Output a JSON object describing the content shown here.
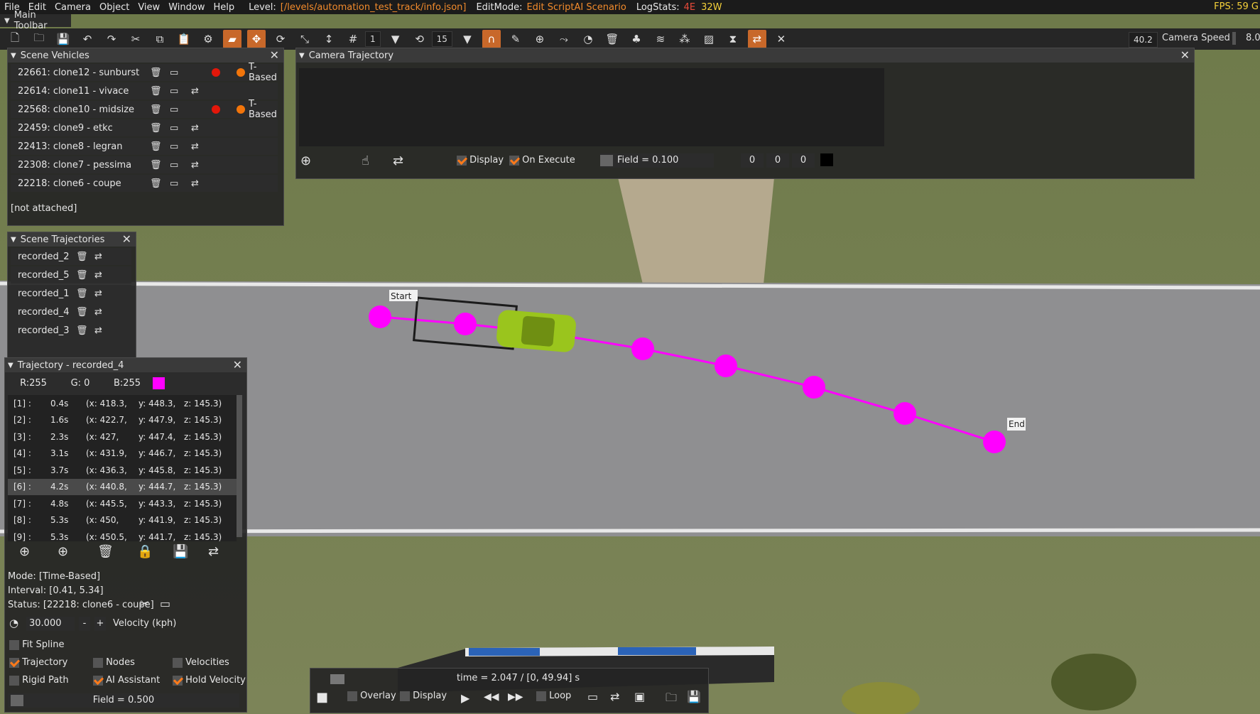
{
  "menu": {
    "items": [
      "File",
      "Edit",
      "Camera",
      "Object",
      "View",
      "Window",
      "Help"
    ],
    "level_label": "Level:",
    "level_value": "[/levels/automation_test_track/info.json]",
    "editmode_label": "EditMode:",
    "editmode_value": "Edit ScriptAI Scenario",
    "logstats_label": "LogStats:",
    "logstats_errors": "4E",
    "logstats_warnings": "32W",
    "fps": "FPS: 59 G"
  },
  "toolbar": {
    "title": "Main Toolbar",
    "value1": "1",
    "value2": "15",
    "speed_value": "40.2",
    "speed_label": "Camera Speed",
    "speed_value2": "8.0"
  },
  "vehicles": {
    "title": "Scene Vehicles",
    "rows": [
      {
        "name": "22661: clone12 - sunburst",
        "tbased": "T-Based"
      },
      {
        "name": "22614: clone11 - vivace",
        "tbased": ""
      },
      {
        "name": "22568: clone10 - midsize",
        "tbased": "T-Based"
      },
      {
        "name": "22459: clone9 - etkc",
        "tbased": ""
      },
      {
        "name": "22413: clone8 - legran",
        "tbased": ""
      },
      {
        "name": "22308: clone7 - pessima",
        "tbased": ""
      },
      {
        "name": "22218: clone6 - coupe",
        "tbased": ""
      }
    ],
    "status": "[not attached]"
  },
  "camera": {
    "title": "Camera Trajectory",
    "display": "Display",
    "on_execute": "On Execute",
    "field": "Field = 0.100",
    "n1": "0",
    "n2": "0",
    "n3": "0"
  },
  "trajectories": {
    "title": "Scene Trajectories",
    "rows": [
      "recorded_2",
      "recorded_5",
      "recorded_1",
      "recorded_4",
      "recorded_3"
    ]
  },
  "trajpanel": {
    "title": "Trajectory - recorded_4",
    "r": "R:255",
    "g": "G: 0",
    "b": "B:255",
    "color": "#ff00ff",
    "rows": [
      {
        "i": "[1] :",
        "t": "0.4s",
        "x": "(x: 418.3,",
        "y": "y: 448.3,",
        "z": "z: 145.3)"
      },
      {
        "i": "[2] :",
        "t": "1.6s",
        "x": "(x: 422.7,",
        "y": "y: 447.9,",
        "z": "z: 145.3)"
      },
      {
        "i": "[3] :",
        "t": "2.3s",
        "x": "(x: 427,",
        "y": "y: 447.4,",
        "z": "z: 145.3)"
      },
      {
        "i": "[4] :",
        "t": "3.1s",
        "x": "(x: 431.9,",
        "y": "y: 446.7,",
        "z": "z: 145.3)"
      },
      {
        "i": "[5] :",
        "t": "3.7s",
        "x": "(x: 436.3,",
        "y": "y: 445.8,",
        "z": "z: 145.3)"
      },
      {
        "i": "[6] :",
        "t": "4.2s",
        "x": "(x: 440.8,",
        "y": "y: 444.7,",
        "z": "z: 145.3)"
      },
      {
        "i": "[7] :",
        "t": "4.8s",
        "x": "(x: 445.5,",
        "y": "y: 443.3,",
        "z": "z: 145.3)"
      },
      {
        "i": "[8] :",
        "t": "5.3s",
        "x": "(x: 450,",
        "y": "y: 441.9,",
        "z": "z: 145.3)"
      },
      {
        "i": "[9] :",
        "t": "5.3s",
        "x": "(x: 450.5,",
        "y": "y: 441.7,",
        "z": "z: 145.3)"
      }
    ],
    "mode": "Mode: [Time-Based]",
    "interval": "Interval: [0.41, 5.34]",
    "status": "Status: [22218: clone6 - coupe]",
    "velocity_value": "30.000",
    "minus": "-",
    "plus": "+",
    "velocity_label": "Velocity (kph)",
    "fit_spline": "Fit Spline",
    "trajectory": "Trajectory",
    "nodes": "Nodes",
    "velocities": "Velocities",
    "rigid_path": "Rigid Path",
    "ai_assistant": "AI Assistant",
    "hold_velocity": "Hold Velocity",
    "field": "Field = 0.500"
  },
  "scene": {
    "start_label": "Start",
    "end_label": "End",
    "path_color": "#ff00ff"
  },
  "playback": {
    "time": "time = 2.047 / [0, 49.94] s",
    "overlay": "Overlay",
    "display": "Display",
    "loop": "Loop"
  }
}
